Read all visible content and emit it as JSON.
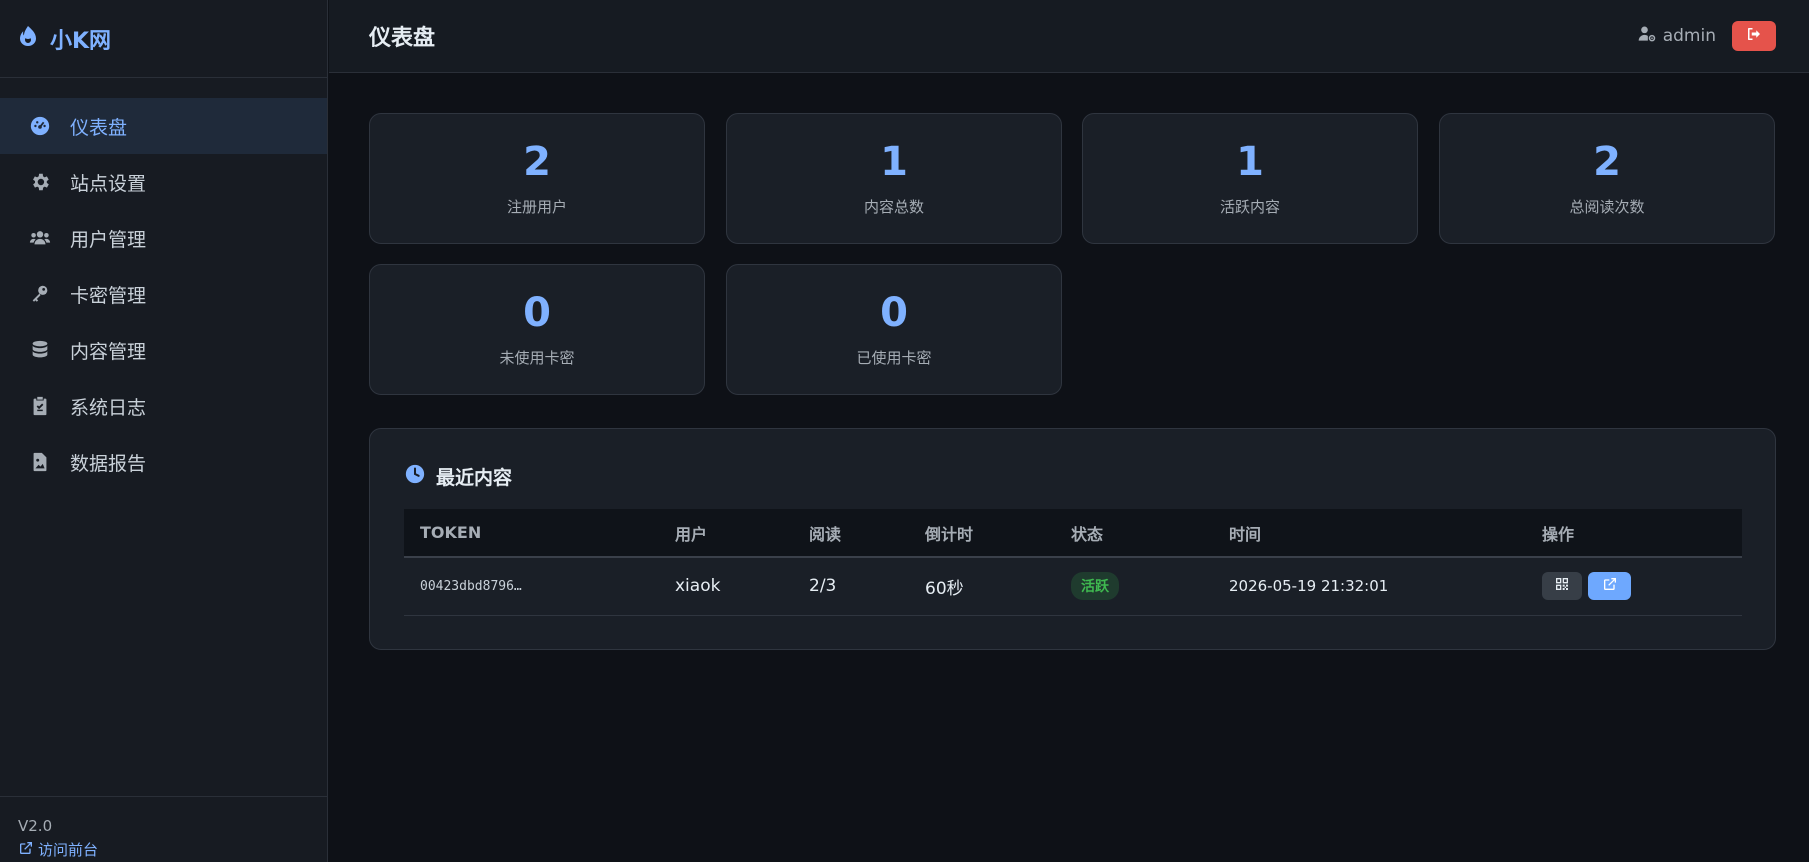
{
  "brand": {
    "name": "小K网",
    "icon": "flame-icon"
  },
  "sidebar": {
    "items": [
      {
        "label": "仪表盘",
        "icon": "dashboard-icon",
        "active": true
      },
      {
        "label": "站点设置",
        "icon": "gear-icon"
      },
      {
        "label": "用户管理",
        "icon": "users-icon"
      },
      {
        "label": "卡密管理",
        "icon": "key-icon"
      },
      {
        "label": "内容管理",
        "icon": "database-icon"
      },
      {
        "label": "系统日志",
        "icon": "clipboard-icon"
      },
      {
        "label": "数据报告",
        "icon": "file-image-icon"
      }
    ],
    "version": "V2.0",
    "front_link": "访问前台"
  },
  "header": {
    "title": "仪表盘",
    "user": "admin",
    "logout_icon": "logout-icon"
  },
  "stats": [
    {
      "value": "2",
      "label": "注册用户"
    },
    {
      "value": "1",
      "label": "内容总数"
    },
    {
      "value": "1",
      "label": "活跃内容"
    },
    {
      "value": "2",
      "label": "总阅读次数"
    },
    {
      "value": "0",
      "label": "未使用卡密"
    },
    {
      "value": "0",
      "label": "已使用卡密"
    }
  ],
  "recent": {
    "title": "最近内容",
    "columns": [
      "TOKEN",
      "用户",
      "阅读",
      "倒计时",
      "状态",
      "时间",
      "操作"
    ],
    "rows": [
      {
        "token": "00423dbd8796…",
        "user": "xiaok",
        "reads": "2/3",
        "countdown": "60秒",
        "status": "活跃",
        "time": "2026-05-19 21:32:01"
      }
    ]
  },
  "colors": {
    "accent": "#7fb1ff",
    "danger": "#e5534b",
    "success": "#3fb950",
    "background": "#0e1117",
    "card": "#1a1f27"
  }
}
